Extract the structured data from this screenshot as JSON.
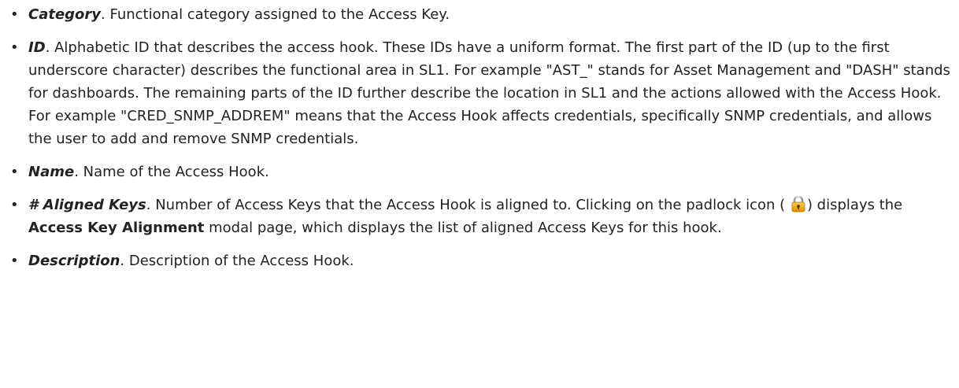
{
  "items": [
    {
      "term": "Category",
      "text": ". Functional category assigned to the Access Key."
    },
    {
      "term": "ID",
      "text": ". Alphabetic ID that describes the access hook. These IDs have a uniform format. The first part of the ID (up to the first underscore character) describes the functional area in SL1. For example \"AST_\" stands for Asset Management and \"DASH\" stands for dashboards. The remaining parts of the ID further describe the location in SL1 and the actions allowed with the Access Hook. For example \"CRED_SNMP_ADDREM\" means that the Access Hook affects credentials, specifically SNMP credentials, and allows the user to add and remove SNMP credentials."
    },
    {
      "term": "Name",
      "text": ". Name of the Access Hook."
    },
    {
      "term": "# Aligned Keys",
      "text_before_icon": ". Number of Access Keys that the Access Hook is aligned to. Clicking on the padlock icon (",
      "icon": "padlock-icon",
      "text_after_icon": ") displays the ",
      "strong": "Access Key Alignment",
      "text_end": " modal page, which displays the list of aligned Access Keys for this hook."
    },
    {
      "term": "Description",
      "text": ". Description of the Access Hook."
    }
  ],
  "bullet_glyph": "•"
}
